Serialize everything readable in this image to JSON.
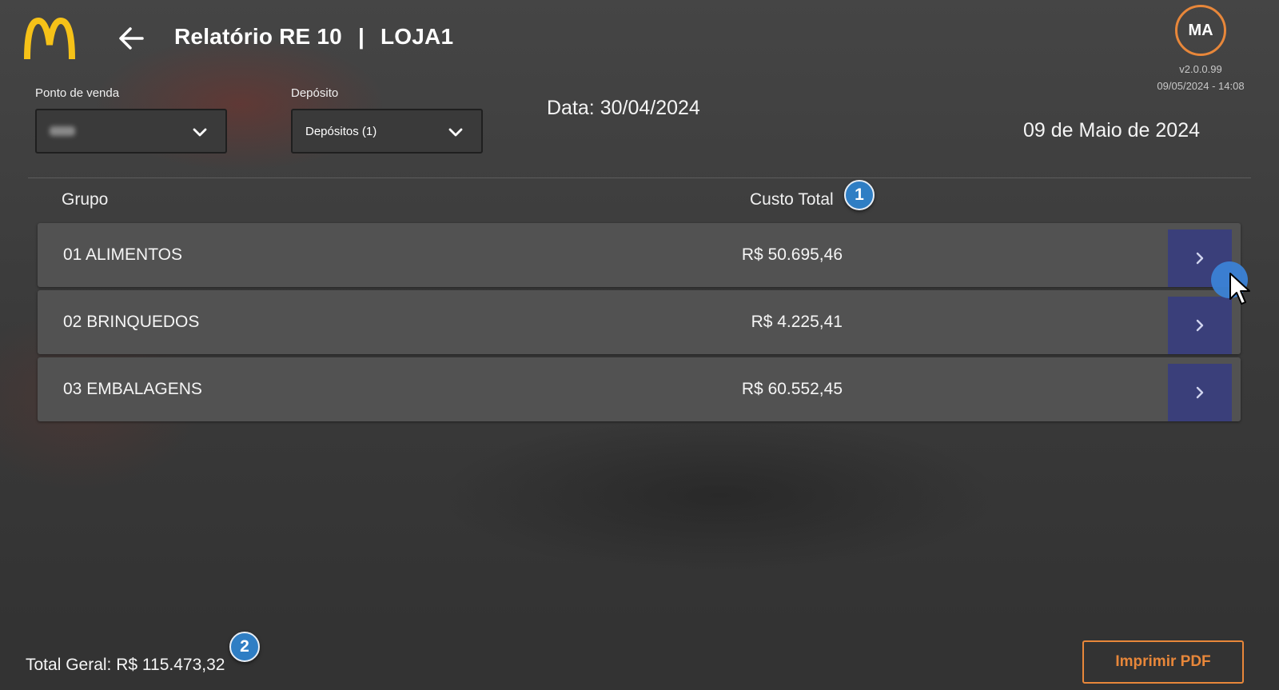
{
  "header": {
    "title": "Relatório RE 10",
    "separator": "|",
    "store": "LOJA1",
    "avatar_initials": "MA",
    "version": "v2.0.0.99",
    "datetime": "09/05/2024 - 14:08"
  },
  "filters": {
    "ponto_label": "Ponto de venda",
    "deposito_label": "Depósito",
    "deposito_value": "Depósitos (1)"
  },
  "dates": {
    "data_label": "Data: 30/04/2024",
    "long_date": "09 de Maio de 2024"
  },
  "table": {
    "headers": {
      "group": "Grupo",
      "cost": "Custo Total"
    },
    "rows": [
      {
        "group": "01 ALIMENTOS",
        "cost": "R$ 50.695,46"
      },
      {
        "group": "02 BRINQUEDOS",
        "cost": "R$ 4.225,41"
      },
      {
        "group": "03 EMBALAGENS",
        "cost": "R$ 60.552,45"
      }
    ]
  },
  "markers": {
    "one": "1",
    "two": "2"
  },
  "footer": {
    "total": "Total Geral: R$ 115.473,32",
    "print_button": "Imprimir PDF"
  },
  "colors": {
    "accent_orange": "#e8873a",
    "logo_yellow": "#f6c218",
    "row_button_blue": "#3a3f7a",
    "marker_blue": "#2f7ec4"
  },
  "icons": [
    "mcdonalds-logo",
    "back-arrow-icon",
    "chevron-down-icon",
    "chevron-right-icon",
    "mouse-cursor-icon"
  ]
}
